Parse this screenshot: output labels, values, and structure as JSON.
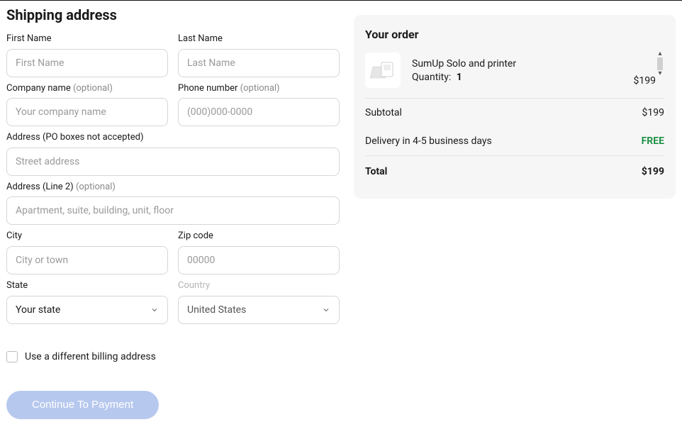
{
  "page": {
    "title": "Shipping address"
  },
  "form": {
    "first_name": {
      "label": "First Name",
      "placeholder": "First Name",
      "value": ""
    },
    "last_name": {
      "label": "Last Name",
      "placeholder": "Last Name",
      "value": ""
    },
    "company": {
      "label": "Company name ",
      "optional": "(optional)",
      "placeholder": "Your company name",
      "value": ""
    },
    "phone": {
      "label": "Phone number ",
      "optional": "(optional)",
      "placeholder": "(000)000-0000",
      "value": ""
    },
    "address": {
      "label": "Address (PO boxes not accepted)",
      "placeholder": "Street address",
      "value": ""
    },
    "address2": {
      "label": "Address (Line 2) ",
      "optional": "(optional)",
      "placeholder": "Apartment, suite, building, unit, floor",
      "value": ""
    },
    "city": {
      "label": "City",
      "placeholder": "City or town",
      "value": ""
    },
    "zip": {
      "label": "Zip code",
      "placeholder": "00000",
      "value": ""
    },
    "state": {
      "label": "State",
      "selected": "Your state"
    },
    "country": {
      "label": "Country",
      "selected": "United States"
    }
  },
  "billing": {
    "label": "Use a different billing address"
  },
  "buttons": {
    "continue": "Continue To Payment"
  },
  "order": {
    "title": "Your order",
    "item": {
      "name": "SumUp Solo and printer",
      "qty_label": "Quantity:",
      "qty": "1",
      "price": "$199"
    },
    "subtotal_label": "Subtotal",
    "subtotal_value": "$199",
    "delivery_label": "Delivery in 4-5 business days",
    "delivery_value": "FREE",
    "total_label": "Total",
    "total_value": "$199"
  }
}
